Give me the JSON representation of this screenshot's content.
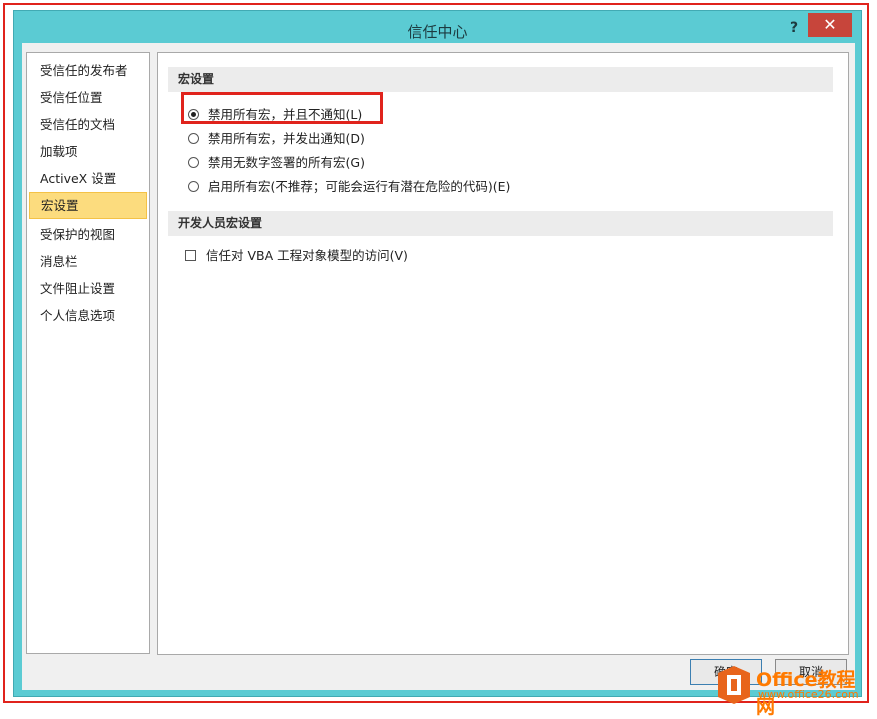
{
  "window": {
    "title": "信任中心",
    "help": "?",
    "close": "✕"
  },
  "nav": {
    "items": [
      {
        "label": "受信任的发布者"
      },
      {
        "label": "受信任位置"
      },
      {
        "label": "受信任的文档"
      },
      {
        "label": "加载项"
      },
      {
        "label": "ActiveX 设置"
      },
      {
        "label": "宏设置",
        "selected": true
      },
      {
        "label": "受保护的视图"
      },
      {
        "label": "消息栏"
      },
      {
        "label": "文件阻止设置"
      },
      {
        "label": "个人信息选项"
      }
    ]
  },
  "macro": {
    "header": "宏设置",
    "options": [
      {
        "label": "禁用所有宏，并且不通知(L)",
        "checked": true
      },
      {
        "label": "禁用所有宏，并发出通知(D)",
        "checked": false
      },
      {
        "label": "禁用无数字签署的所有宏(G)",
        "checked": false
      },
      {
        "label": "启用所有宏(不推荐；可能会运行有潜在危险的代码)(E)",
        "checked": false
      }
    ]
  },
  "developer": {
    "header": "开发人员宏设置",
    "vba_label": "信任对 VBA 工程对象模型的访问(V)",
    "vba_checked": false
  },
  "buttons": {
    "ok": "确定",
    "cancel": "取消"
  },
  "watermark": {
    "brand": "Office教程网",
    "url": "www.office26.com"
  },
  "colors": {
    "titlebar": "#5bcbd3",
    "highlight": "#e0231c",
    "selected": "#fcdc7e",
    "close": "#c7453b"
  }
}
